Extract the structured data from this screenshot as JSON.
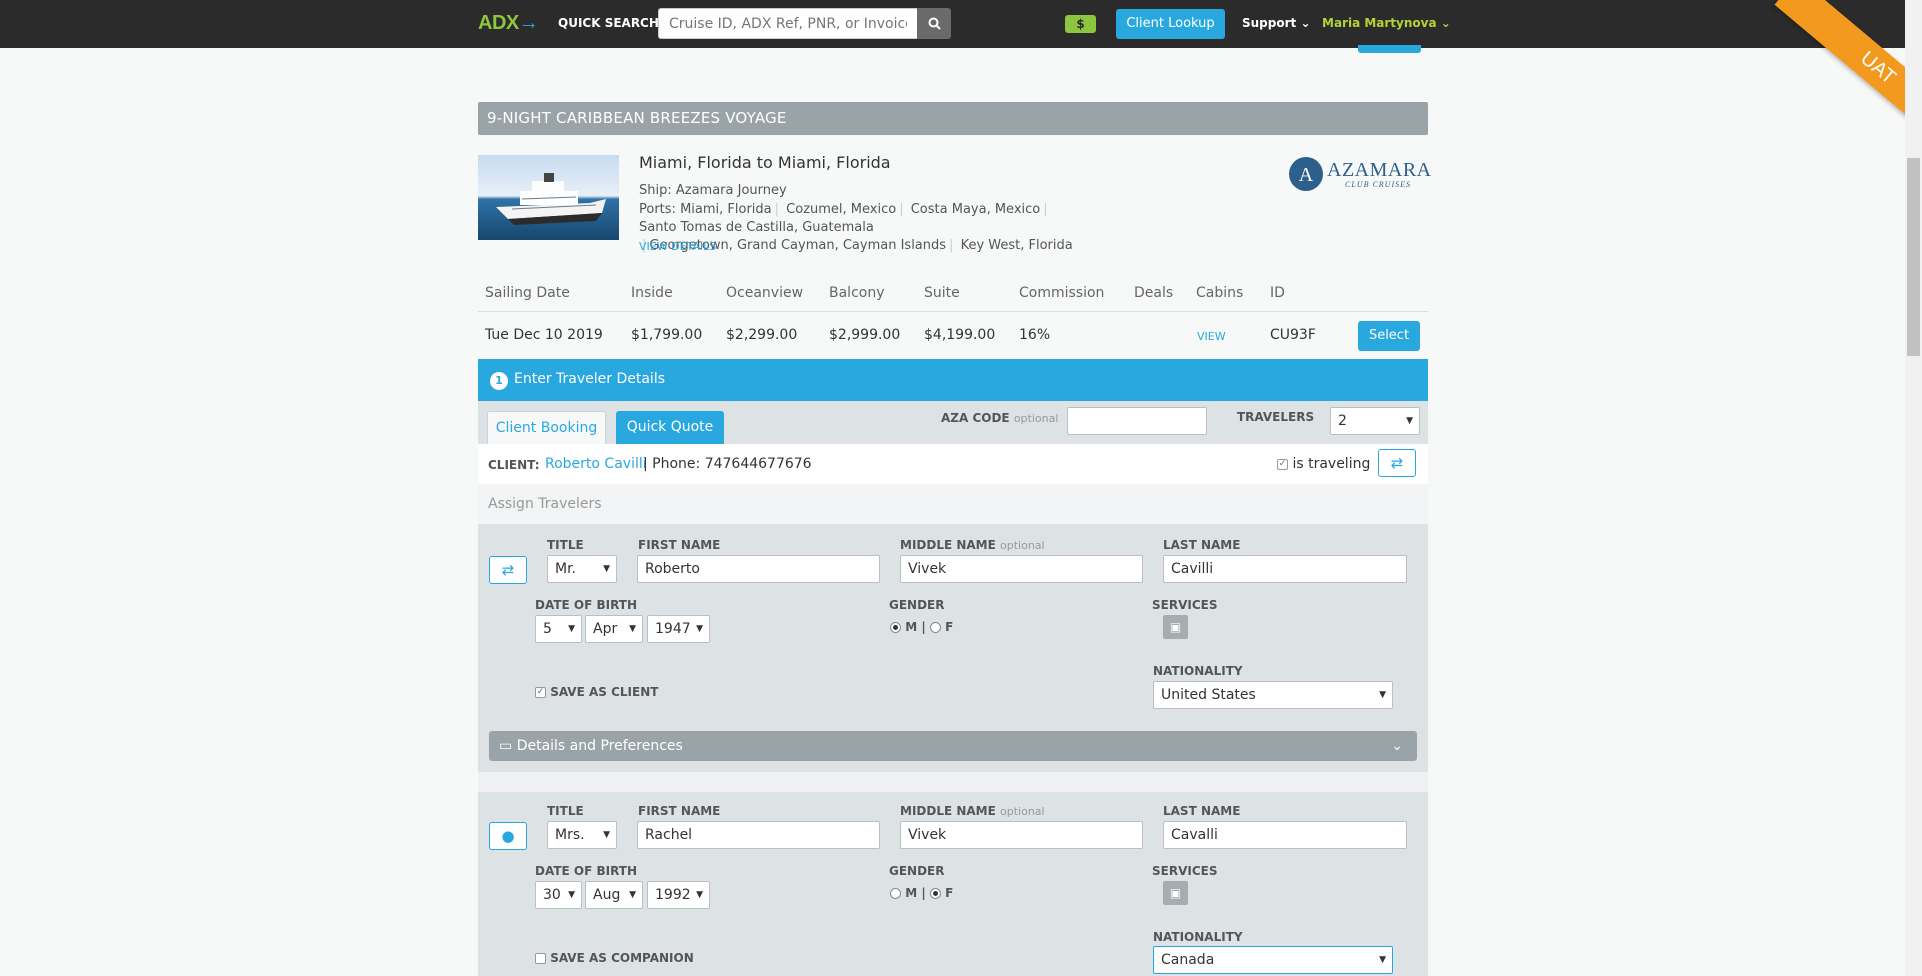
{
  "topbar": {
    "logo": "ADX",
    "logo_arrow": "→",
    "quick_search_label": "QUICK SEARCH",
    "search_placeholder": "Cruise ID, ADX Ref, PNR, or Invoice #.",
    "search_icon": "search-icon",
    "dollar_badge": "$",
    "client_lookup": "Client Lookup",
    "support": "Support",
    "user_name": "Maria Martynova",
    "env_ribbon": "UAT"
  },
  "voyage": {
    "title": "9-NIGHT CARIBBEAN BREEZES VOYAGE",
    "route": "Miami, Florida to Miami, Florida",
    "ship": "Ship: Azamara Journey",
    "ports_label": "Ports:",
    "ports": [
      "Miami, Florida",
      "Cozumel, Mexico",
      "Costa Maya, Mexico",
      "Santo Tomas de Castilla, Guatemala",
      "Georgetown, Grand Cayman, Cayman Islands",
      "Key West, Florida"
    ],
    "view_details": "VIEW DETAILS",
    "brand_name": "AZAMARA",
    "brand_sub": "CLUB CRUISES"
  },
  "pricing": {
    "headers": [
      "Sailing Date",
      "Inside",
      "Oceanview",
      "Balcony",
      "Suite",
      "Commission",
      "Deals",
      "Cabins",
      "ID"
    ],
    "row": {
      "date": "Tue Dec 10 2019",
      "inside": "$1,799.00",
      "oceanview": "$2,299.00",
      "balcony": "$2,999.00",
      "suite": "$4,199.00",
      "commission": "16%",
      "cabins": "VIEW",
      "id": "CU93F",
      "select": "Select"
    }
  },
  "step": {
    "number": "1",
    "label": "Enter Traveler Details"
  },
  "tabs": {
    "client_booking": "Client Booking",
    "quick_quote": "Quick Quote"
  },
  "aza_code": {
    "label": "AZA CODE",
    "optional": "optional",
    "value": ""
  },
  "travelers": {
    "label": "TRAVELERS",
    "value": "2"
  },
  "client": {
    "label": "CLIENT:",
    "name": "Roberto Cavilli",
    "phone": "| Phone: 747644677676",
    "is_traveling": "is traveling"
  },
  "assign": "Assign Travelers",
  "labels": {
    "title": "TITLE",
    "first_name": "FIRST NAME",
    "middle_name": "MIDDLE NAME",
    "optional": "optional",
    "last_name": "LAST NAME",
    "dob": "DATE OF BIRTH",
    "gender": "GENDER",
    "services": "SERVICES",
    "nationality": "NATIONALITY",
    "m": "M",
    "f": "F",
    "pipe": "|"
  },
  "traveler1": {
    "title": "Mr.",
    "first": "Roberto",
    "middle": "Vivek",
    "last": "Cavilli",
    "dob_day": "5",
    "dob_month": "Apr",
    "dob_year": "1947",
    "gender": "M",
    "save_label": "SAVE AS CLIENT",
    "nationality": "United States"
  },
  "details_bar": "Details and Preferences",
  "traveler2": {
    "title": "Mrs.",
    "first": "Rachel",
    "middle": "Vivek",
    "last": "Cavalli",
    "dob_day": "30",
    "dob_month": "Aug",
    "dob_year": "1992",
    "gender": "F",
    "save_label": "SAVE AS COMPANION",
    "nationality": "Canada"
  },
  "colors": {
    "accent": "#29a8e0",
    "brand_green": "#8cc63f",
    "topbar": "#2b2b2b",
    "uat": "#f39a1e"
  }
}
